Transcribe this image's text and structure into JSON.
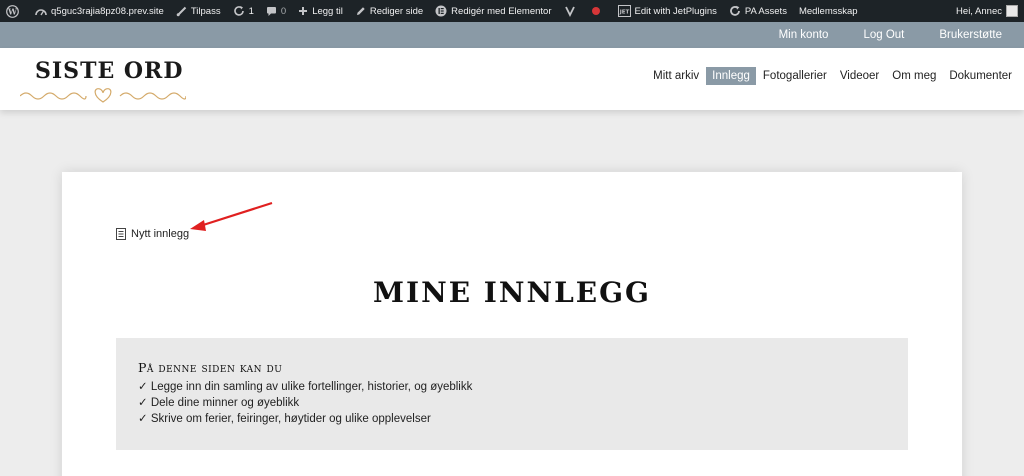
{
  "adminbar": {
    "site": "q5guc3rajia8pz08.prev.site",
    "customize": "Tilpass",
    "updates": "1",
    "comments": "0",
    "new": "Legg til",
    "edit_page": "Rediger side",
    "elementor": "Redigér med Elementor",
    "jetplugins": "Edit with JetPlugins",
    "pa_assets": "PA Assets",
    "membership": "Medlemsskap",
    "greeting": "Hei, Annec"
  },
  "topbar": {
    "items": [
      "Min konto",
      "Log Out",
      "Brukerstøtte"
    ]
  },
  "logo": {
    "text": "SISTE ORD"
  },
  "nav": {
    "items": [
      "Mitt arkiv",
      "Innlegg",
      "Fotogallerier",
      "Videoer",
      "Om meg",
      "Dokumenter"
    ],
    "active": "Innlegg"
  },
  "content": {
    "new_post": "Nytt innlegg",
    "title": "MINE INNLEGG",
    "info_title": "På denne siden kan du",
    "info_items": [
      "✓ Legge inn din samling av ulike fortellinger, historier, og øyeblikk",
      "✓ Dele dine minner og øyeblikk",
      "✓ Skrive om ferier, feiringer, høytider og ulike opplevelser"
    ]
  },
  "colors": {
    "adminbar_bg": "#1d2327",
    "accent": "#8a9aa6",
    "logo_gold": "#d4aa6a",
    "annotation_arrow": "#e02020"
  }
}
